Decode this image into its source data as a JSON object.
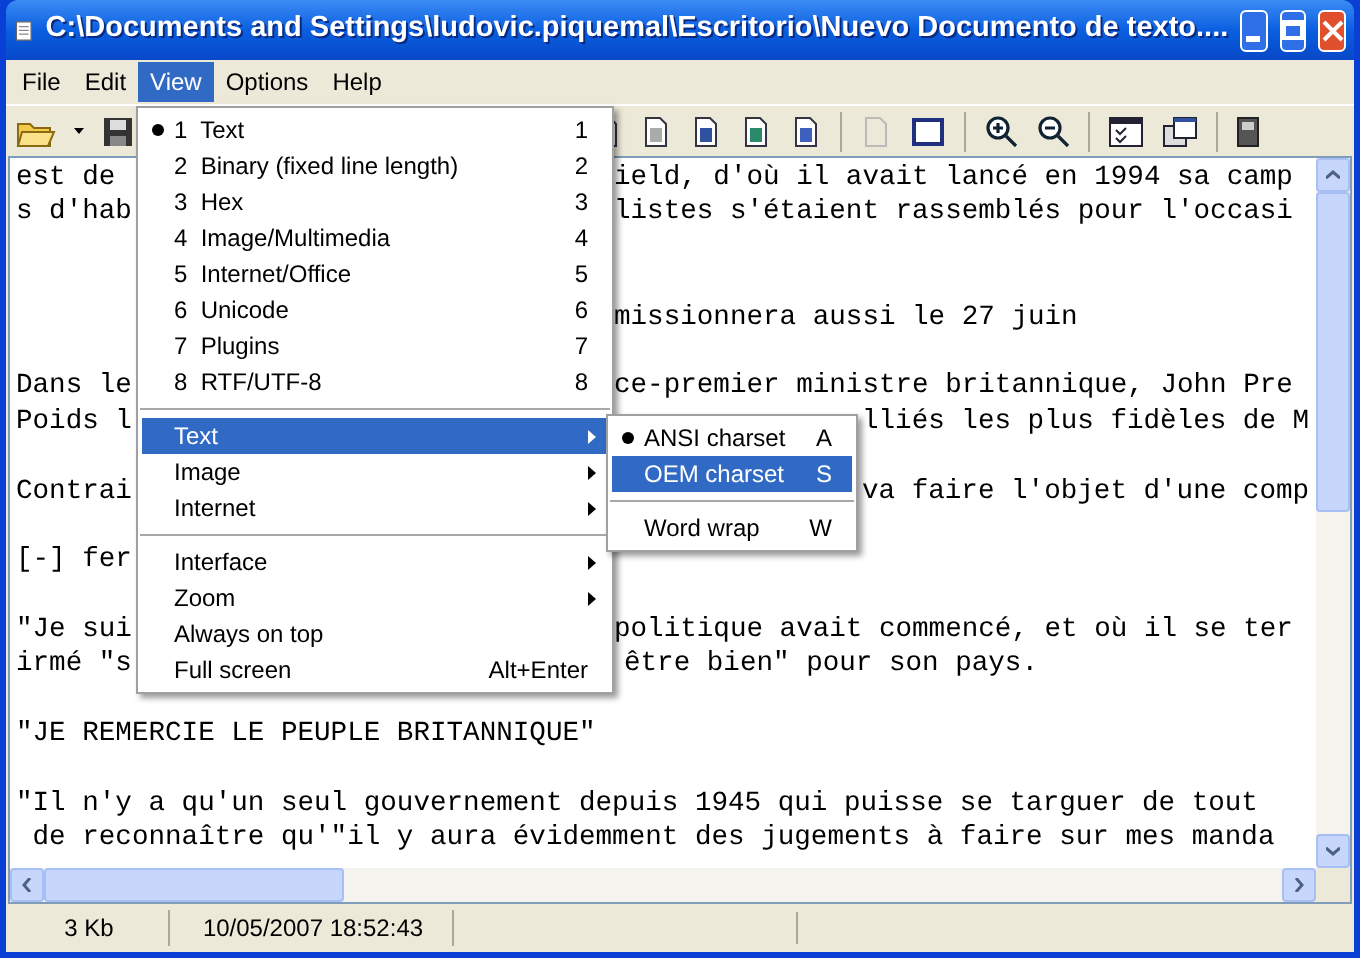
{
  "window": {
    "title": "C:\\Documents and Settings\\ludovic.piquemal\\Escritorio\\Nuevo Documento de texto...."
  },
  "menu_bar": [
    {
      "label": "File",
      "selected": false
    },
    {
      "label": "Edit",
      "selected": false
    },
    {
      "label": "View",
      "selected": true
    },
    {
      "label": "Options",
      "selected": false
    },
    {
      "label": "Help",
      "selected": false
    }
  ],
  "document": {
    "paragraphs": [
      {
        "lines": [
          {
            "left": "est de",
            "right": "ield, d'où il avait lancé en 1994 sa camp"
          },
          {
            "left": "s d'hab",
            "right": "listes s'étaient rassemblés pour l'occasi"
          }
        ]
      },
      {
        "lines": [
          {
            "right": "missionnera aussi le 27 juin"
          }
        ]
      },
      {
        "lines": [
          {
            "left": "Dans le",
            "right": "ce-premier ministre britannique, John Pre"
          },
          {
            "left": "Poids l",
            "right": "lliés les plus fidèles de M"
          }
        ]
      },
      {
        "lines": [
          {
            "left": "Contrai",
            "right": "va faire l'objet d'une comp"
          }
        ]
      },
      {
        "lines": [
          {
            "left": "[-] fer"
          }
        ]
      },
      {
        "lines": [
          {
            "left": "\"Je sui",
            "right": "politique avait commencé, et où il se ter"
          },
          {
            "left": "irmé \"s",
            "right": "être bien\" pour son pays."
          }
        ]
      },
      {
        "lines": [
          {
            "left": "\"JE REMERCIE LE PEUPLE BRITANNIQUE\""
          }
        ]
      },
      {
        "lines": [
          {
            "left": "\"Il n'y a qu'un seul gouvernement depuis 1945 qui puisse se targuer de tout"
          },
          {
            "left": " de reconnaître qu'\"il y aura évidemment des jugements à faire sur mes manda"
          }
        ]
      }
    ]
  },
  "view_menu": [
    {
      "kind": "radio",
      "label": "1  Text",
      "shortcut": "1",
      "checked": true,
      "selected": false
    },
    {
      "kind": "radio",
      "label": "2  Binary (fixed line length)",
      "shortcut": "2",
      "checked": false,
      "selected": false
    },
    {
      "kind": "radio",
      "label": "3  Hex",
      "shortcut": "3",
      "checked": false,
      "selected": false
    },
    {
      "kind": "radio",
      "label": "4  Image/Multimedia",
      "shortcut": "4",
      "checked": false,
      "selected": false
    },
    {
      "kind": "radio",
      "label": "5  Internet/Office",
      "shortcut": "5",
      "checked": false,
      "selected": false
    },
    {
      "kind": "radio",
      "label": "6  Unicode",
      "shortcut": "6",
      "checked": false,
      "selected": false
    },
    {
      "kind": "radio",
      "label": "7  Plugins",
      "shortcut": "7",
      "checked": false,
      "selected": false
    },
    {
      "kind": "radio",
      "label": "8  RTF/UTF-8",
      "shortcut": "8",
      "checked": false,
      "selected": false
    },
    {
      "kind": "separator"
    },
    {
      "kind": "submenu",
      "label": "Text",
      "selected": true
    },
    {
      "kind": "submenu",
      "label": "Image",
      "selected": false
    },
    {
      "kind": "submenu",
      "label": "Internet",
      "selected": false
    },
    {
      "kind": "separator"
    },
    {
      "kind": "submenu",
      "label": "Interface",
      "selected": false
    },
    {
      "kind": "submenu",
      "label": "Zoom",
      "selected": false
    },
    {
      "kind": "command",
      "label": "Always on top",
      "selected": false
    },
    {
      "kind": "command",
      "label": "Full screen",
      "shortcut": "Alt+Enter",
      "selected": false
    }
  ],
  "text_submenu": [
    {
      "kind": "radio",
      "label": "ANSI charset",
      "shortcut": "A",
      "checked": true,
      "selected": false
    },
    {
      "kind": "radio",
      "label": "OEM charset",
      "shortcut": "S",
      "checked": false,
      "selected": true
    },
    {
      "kind": "separator"
    },
    {
      "kind": "command",
      "label": "Word wrap",
      "shortcut": "W",
      "selected": false
    }
  ],
  "status_bar": [
    "3 Kb",
    "10/05/2007 18:52:43"
  ]
}
